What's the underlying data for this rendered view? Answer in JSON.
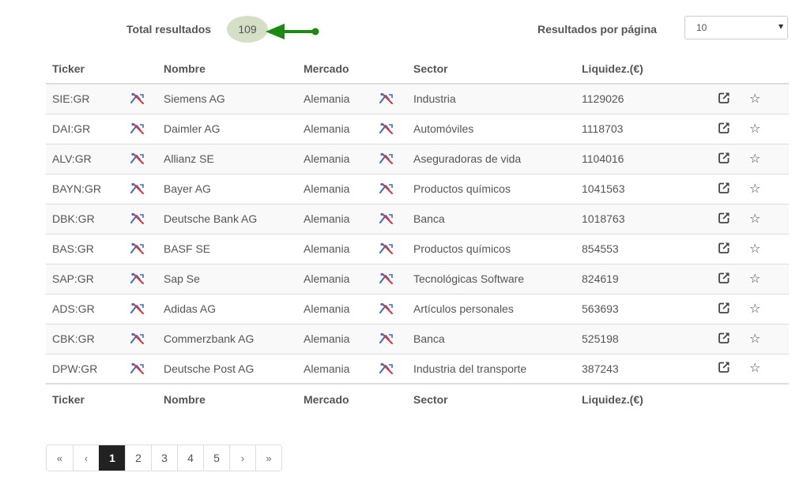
{
  "summary": {
    "total_label": "Total resultados",
    "total_count": "109",
    "per_page_label": "Resultados por página",
    "per_page_value": "10"
  },
  "table": {
    "headers": {
      "ticker": "Ticker",
      "nombre": "Nombre",
      "mercado": "Mercado",
      "sector": "Sector",
      "liquidez": "Liquidez.(€)"
    },
    "rows": [
      {
        "ticker": "SIE:GR",
        "nombre": "Siemens AG",
        "mercado": "Alemania",
        "sector": "Industria",
        "liquidez": "1129026"
      },
      {
        "ticker": "DAI:GR",
        "nombre": "Daimler AG",
        "mercado": "Alemania",
        "sector": "Automóviles",
        "liquidez": "1118703"
      },
      {
        "ticker": "ALV:GR",
        "nombre": "Allianz SE",
        "mercado": "Alemania",
        "sector": "Aseguradoras de vida",
        "liquidez": "1104016"
      },
      {
        "ticker": "BAYN:GR",
        "nombre": "Bayer AG",
        "mercado": "Alemania",
        "sector": "Productos químicos",
        "liquidez": "1041563"
      },
      {
        "ticker": "DBK:GR",
        "nombre": "Deutsche Bank AG",
        "mercado": "Alemania",
        "sector": "Banca",
        "liquidez": "1018763"
      },
      {
        "ticker": "BAS:GR",
        "nombre": "BASF SE",
        "mercado": "Alemania",
        "sector": "Productos químicos",
        "liquidez": "854553"
      },
      {
        "ticker": "SAP:GR",
        "nombre": "Sap Se",
        "mercado": "Alemania",
        "sector": "Tecnológicas Software",
        "liquidez": "824619"
      },
      {
        "ticker": "ADS:GR",
        "nombre": "Adidas AG",
        "mercado": "Alemania",
        "sector": "Artículos personales",
        "liquidez": "563693"
      },
      {
        "ticker": "CBK:GR",
        "nombre": "Commerzbank AG",
        "mercado": "Alemania",
        "sector": "Banca",
        "liquidez": "525198"
      },
      {
        "ticker": "DPW:GR",
        "nombre": "Deutsche Post AG",
        "mercado": "Alemania",
        "sector": "Industria del transporte",
        "liquidez": "387243"
      }
    ]
  },
  "pagination": {
    "first": "«",
    "prev": "‹",
    "pages": [
      "1",
      "2",
      "3",
      "4",
      "5"
    ],
    "active_page": "1",
    "next": "›",
    "last": "»"
  },
  "icons": {
    "row_tool": "chart-tools-icon",
    "open": "external-link-icon",
    "favorite": "star-outline-icon"
  },
  "colors": {
    "arrow": "#1a8a10",
    "badge_bg": "#d4dfc6",
    "active_page_bg": "#222222",
    "tool_icon_blue": "#3a6fc4",
    "tool_icon_red": "#d9363e"
  }
}
